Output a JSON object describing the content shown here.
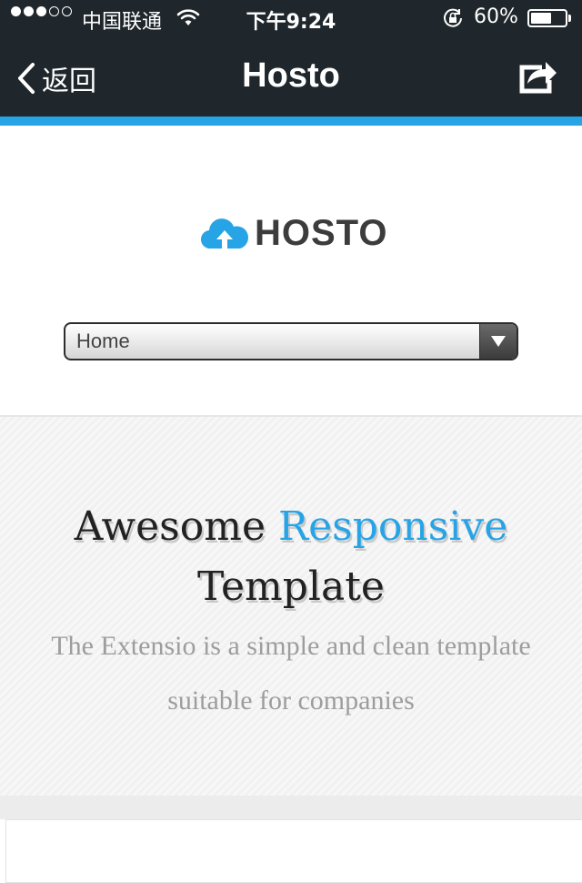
{
  "status_bar": {
    "signal_icon": "signal-dots-icon",
    "carrier": "中国联通",
    "time": "下午9:24",
    "battery_percent": "60%",
    "battery_level": 0.6
  },
  "nav": {
    "back_label": "返回",
    "title": "Hosto",
    "share_icon": "share-icon"
  },
  "header": {
    "logo_text": "HOSTO",
    "logo_icon": "cloud-upload-icon",
    "menu_select": {
      "selected": "Home"
    }
  },
  "hero": {
    "title_part1": "Awesome",
    "title_accent": "Responsive",
    "title_part2": "Template",
    "subtitle": "The Extensio is a simple and clean template suitable for companies"
  },
  "colors": {
    "accent": "#27a4e6",
    "navbar": "#1f272c",
    "title_text": "#222222",
    "subtitle_text": "#9d9d9d"
  }
}
